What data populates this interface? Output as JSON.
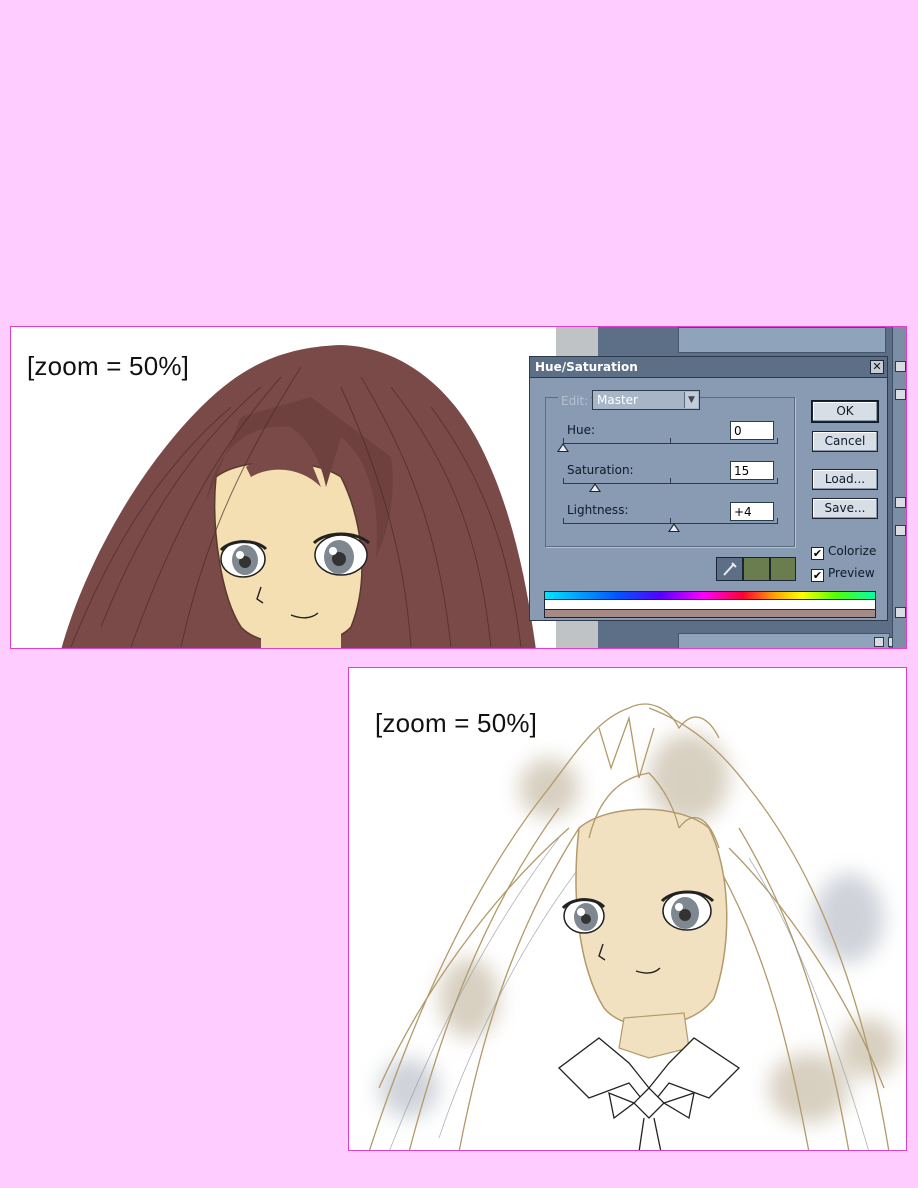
{
  "panels": {
    "before": {
      "zoom_label": "[zoom = 50%]"
    },
    "after": {
      "zoom_label": "[zoom = 50%]"
    }
  },
  "dialog": {
    "title": "Hue/Saturation",
    "close_glyph": "✕",
    "edit": {
      "label": "Edit:",
      "selected": "Master"
    },
    "hue": {
      "label": "Hue:",
      "value": "0"
    },
    "saturation": {
      "label": "Saturation:",
      "value": "15"
    },
    "lightness": {
      "label": "Lightness:",
      "value": "+4"
    },
    "buttons": {
      "ok": "OK",
      "cancel": "Cancel",
      "load": "Load...",
      "save": "Save..."
    },
    "colorize": {
      "label": "Colorize",
      "checked": true
    },
    "preview": {
      "label": "Preview",
      "checked": true
    },
    "icons": {
      "eyedropper": "eyedropper-icon",
      "eyedropper_plus": "eyedropper-plus-icon",
      "eyedropper_minus": "eyedropper-minus-icon"
    },
    "colors": {
      "colorize_result": "#a58a86",
      "swatch_green": "#6a7d4f"
    }
  }
}
